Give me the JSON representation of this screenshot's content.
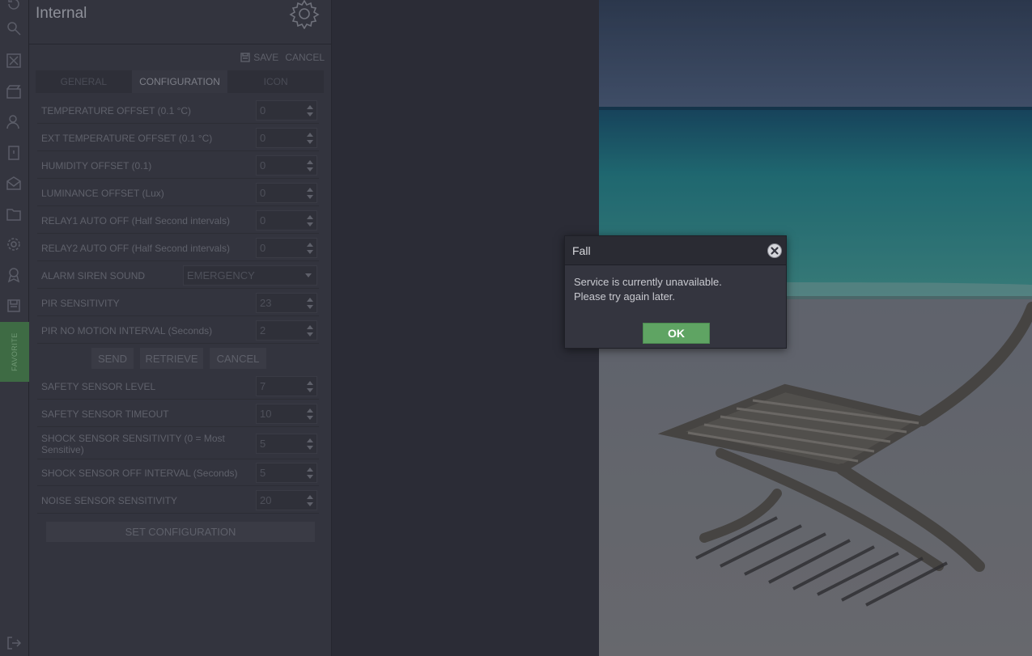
{
  "panel": {
    "title": "Internal",
    "save_label": "SAVE",
    "cancel_label": "CANCEL",
    "tabs": [
      {
        "label": "GENERAL"
      },
      {
        "label": "CONFIGURATION"
      },
      {
        "label": "ICON"
      }
    ],
    "active_tab": "CONFIGURATION",
    "rows": [
      {
        "label": "TEMPERATURE OFFSET (0.1 °C)",
        "value": "0"
      },
      {
        "label": "EXT TEMPERATURE OFFSET (0.1 °C)",
        "value": "0"
      },
      {
        "label": "HUMIDITY OFFSET (0.1)",
        "value": "0"
      },
      {
        "label": "LUMINANCE OFFSET (Lux)",
        "value": "0"
      },
      {
        "label": "RELAY1 AUTO OFF (Half Second intervals)",
        "value": "0"
      },
      {
        "label": "RELAY2 AUTO OFF (Half Second intervals)",
        "value": "0"
      },
      {
        "label": "ALARM SIREN SOUND",
        "value": "EMERGENCY"
      },
      {
        "label": "PIR SENSITIVITY",
        "value": "23"
      },
      {
        "label": "PIR NO MOTION INTERVAL (Seconds)",
        "value": "2"
      }
    ],
    "buttons": {
      "send": "SEND",
      "retrieve": "RETRIEVE",
      "cancel": "CANCEL"
    },
    "rows2": [
      {
        "label": "SAFETY SENSOR LEVEL",
        "value": "7"
      },
      {
        "label": "SAFETY SENSOR TIMEOUT",
        "value": "10"
      },
      {
        "label": "SHOCK SENSOR SENSITIVITY (0 = Most Sensitive)",
        "value": "5"
      },
      {
        "label": "SHOCK SENSOR OFF INTERVAL (Seconds)",
        "value": "5"
      },
      {
        "label": "NOISE SENSOR SENSITIVITY",
        "value": "20"
      }
    ],
    "set_config_label": "SET CONFIGURATION"
  },
  "rail": {
    "favorite_label": "FAVORITE",
    "icons": [
      "refresh-icon",
      "search-icon",
      "expand-icon",
      "scene-icon",
      "users-icon",
      "device-icon",
      "mail-icon",
      "folder-icon",
      "settings-icon",
      "award-icon",
      "save-icon",
      "logout-icon"
    ]
  },
  "dialog": {
    "title": "Fall",
    "message_line1": "Service is currently unavailable.",
    "message_line2": "Please try again later.",
    "ok_label": "OK"
  },
  "colors": {
    "ok_button": "#5fa463",
    "favorite_tab": "#3e6b44",
    "panel_bg": "#33343e"
  }
}
